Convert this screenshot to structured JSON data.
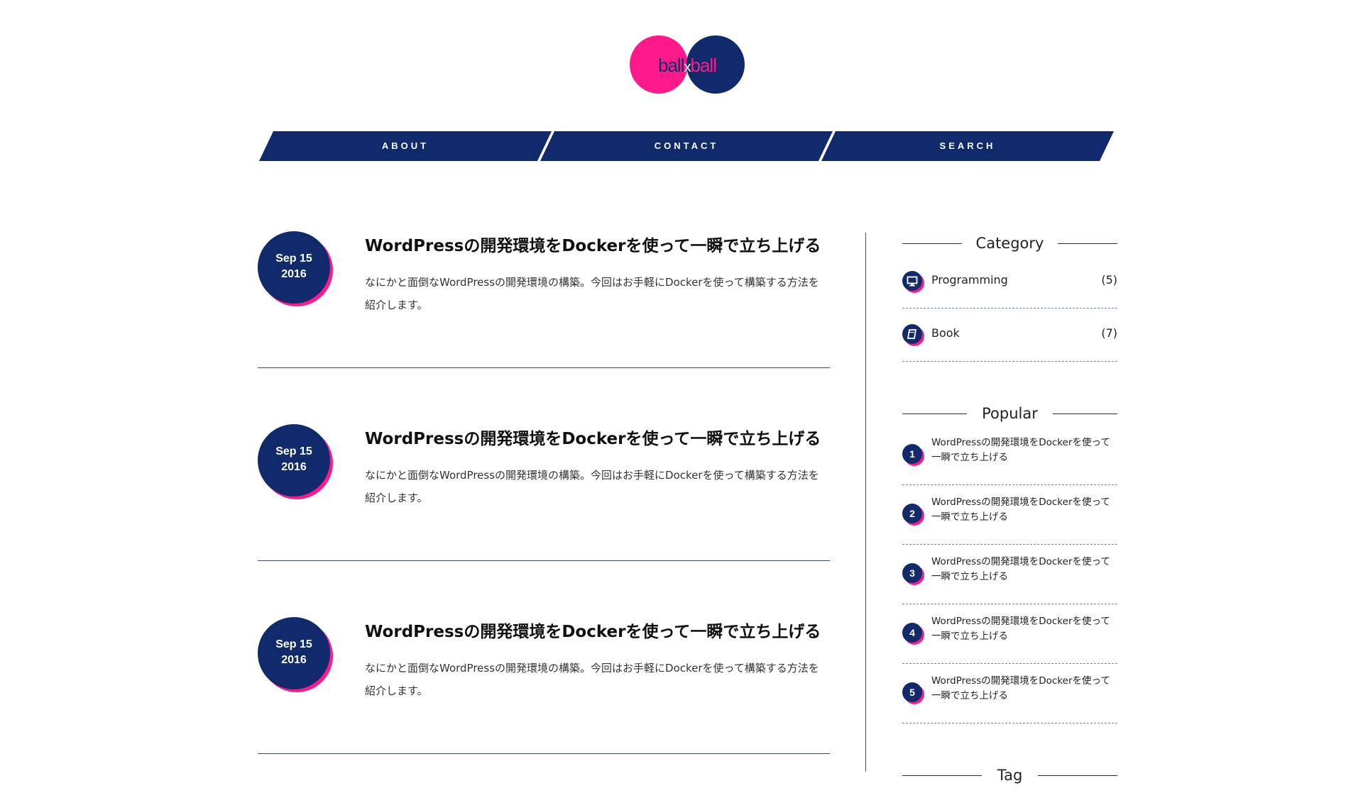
{
  "logo": {
    "part1": "ball",
    "separator": "x",
    "part2": "ball",
    "colors": {
      "pink": "#ff1a8c",
      "navy": "#102a6b"
    }
  },
  "nav": {
    "items": [
      {
        "label": "ABOUT"
      },
      {
        "label": "CONTACT"
      },
      {
        "label": "SEARCH"
      }
    ]
  },
  "posts": [
    {
      "date_line1": "Sep 15",
      "date_line2": "2016",
      "title": "WordPressの開発環境をDockerを使って一瞬で立ち上げる",
      "excerpt": "なにかと面倒なWordPressの開発環境の構築。今回はお手軽にDockerを使って構築する方法を紹介します。"
    },
    {
      "date_line1": "Sep 15",
      "date_line2": "2016",
      "title": "WordPressの開発環境をDockerを使って一瞬で立ち上げる",
      "excerpt": "なにかと面倒なWordPressの開発環境の構築。今回はお手軽にDockerを使って構築する方法を紹介します。"
    },
    {
      "date_line1": "Sep 15",
      "date_line2": "2016",
      "title": "WordPressの開発環境をDockerを使って一瞬で立ち上げる",
      "excerpt": "なにかと面倒なWordPressの開発環境の構築。今回はお手軽にDockerを使って構築する方法を紹介します。"
    }
  ],
  "sidebar": {
    "category": {
      "heading": "Category",
      "items": [
        {
          "label": "Programming",
          "count": "(5)",
          "icon": "monitor-icon"
        },
        {
          "label": "Book",
          "count": "(7)",
          "icon": "book-icon"
        }
      ]
    },
    "popular": {
      "heading": "Popular",
      "items": [
        {
          "rank": "1",
          "title": "WordPressの開発環境をDockerを使って一瞬で立ち上げる"
        },
        {
          "rank": "2",
          "title": "WordPressの開発環境をDockerを使って一瞬で立ち上げる"
        },
        {
          "rank": "3",
          "title": "WordPressの開発環境をDockerを使って一瞬で立ち上げる"
        },
        {
          "rank": "4",
          "title": "WordPressの開発環境をDockerを使って一瞬で立ち上げる"
        },
        {
          "rank": "5",
          "title": "WordPressの開発環境をDockerを使って一瞬で立ち上げる"
        }
      ]
    },
    "tag": {
      "heading": "Tag"
    }
  }
}
